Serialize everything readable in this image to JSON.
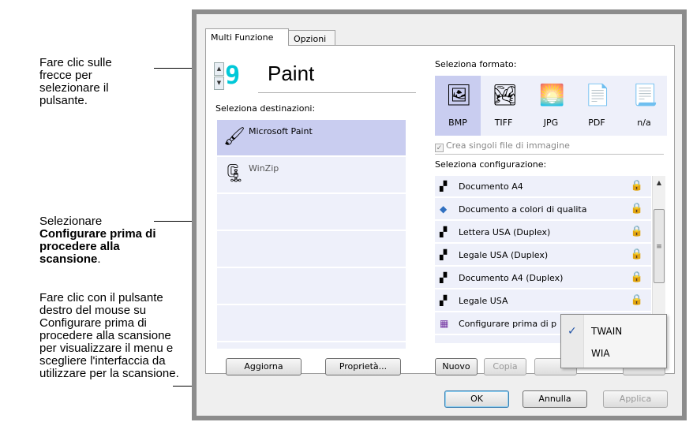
{
  "callouts": {
    "arrows_text": "Fare clic sulle frecce per selezionare il pulsante.",
    "select_prefix": "Selezionare",
    "select_bold": "Configurare prima di procedere alla scansione",
    "select_suffix": ".",
    "right_click_text": "Fare clic con il pulsante destro del mouse su Configurare prima di procedere alla scansione per visualizzare il menu e scegliere l'interfaccia da utilizzare per la scansione."
  },
  "tabs": [
    {
      "label": "Multi Funzione"
    },
    {
      "label": "Opzioni"
    }
  ],
  "button_number": "9",
  "button_name": "Paint",
  "destinations": {
    "label": "Seleziona destinazioni:",
    "items": [
      {
        "label": "Microsoft Paint",
        "icon": "paint-brush-icon",
        "selected": true
      },
      {
        "label": "WinZip",
        "icon": "winzip-icon",
        "selected": false
      }
    ]
  },
  "formats": {
    "label": "Seleziona formato:",
    "items": [
      {
        "label": "BMP",
        "icon": "bmp-icon",
        "selected": true
      },
      {
        "label": "TIFF",
        "icon": "tiff-icon",
        "selected": false
      },
      {
        "label": "JPG",
        "icon": "jpg-icon",
        "selected": false
      },
      {
        "label": "PDF",
        "icon": "pdf-icon",
        "selected": false
      },
      {
        "label": "n/a",
        "icon": "na-icon",
        "selected": false
      }
    ],
    "single_files_checkbox": "Crea singoli file di immagine",
    "single_files_checked": true
  },
  "configurations": {
    "label": "Seleziona configurazione:",
    "items": [
      {
        "label": "Documento A4",
        "icon": "bw-scanner-icon",
        "locked": true
      },
      {
        "label": "Documento a colori di qualita",
        "icon": "color-scanner-icon",
        "locked": true
      },
      {
        "label": "Lettera USA (Duplex)",
        "icon": "bw-scanner-icon",
        "locked": true
      },
      {
        "label": "Legale USA (Duplex)",
        "icon": "bw-scanner-icon",
        "locked": true
      },
      {
        "label": "Documento A4 (Duplex)",
        "icon": "bw-scanner-icon",
        "locked": true
      },
      {
        "label": "Legale USA",
        "icon": "bw-scanner-icon",
        "locked": true
      },
      {
        "label": "Configurare prima di p",
        "icon": "configure-icon",
        "locked": false
      }
    ]
  },
  "context_menu": {
    "items": [
      {
        "label": "TWAIN",
        "checked": true
      },
      {
        "label": "WIA",
        "checked": false
      }
    ]
  },
  "buttons": {
    "refresh": "Aggiorna",
    "properties": "Proprietà...",
    "new": "Nuovo",
    "copy": "Copia",
    "ok": "OK",
    "cancel": "Annulla",
    "apply": "Applica"
  },
  "colors": {
    "led": "#00c8d8",
    "selection": "#c9cdf0",
    "list_bg": "#eef0fa"
  }
}
